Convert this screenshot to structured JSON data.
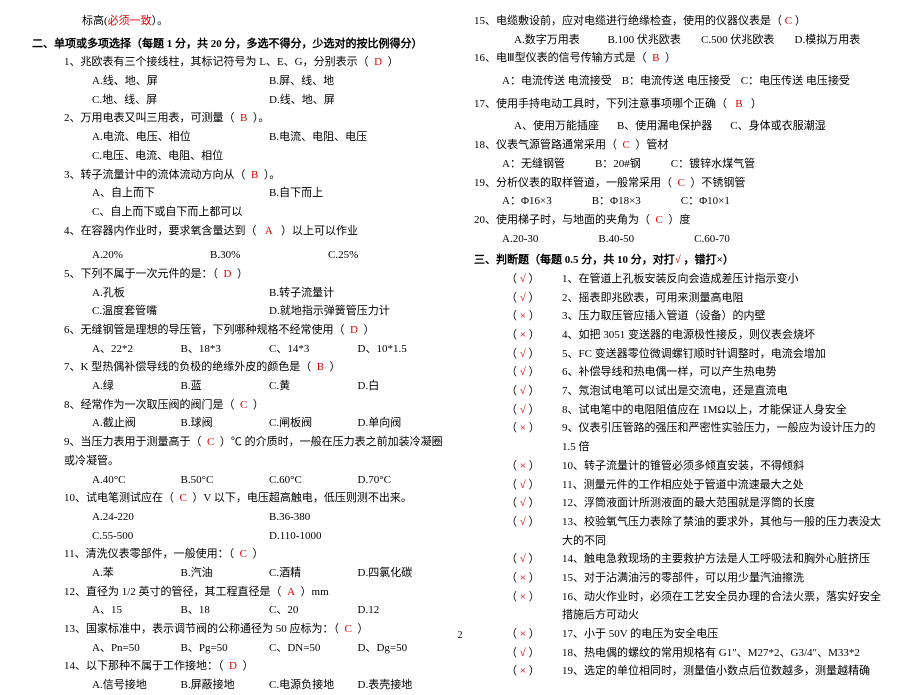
{
  "left": {
    "preline": "标高(",
    "preline_red": "必须一致",
    "preline_end": "）。",
    "sec2_title": "二、单项或多项选择（每题 1 分，共 20 分，多选不得分，少选对的按比例得分）",
    "q1": "1、兆欧表有三个接线柱，其标记符号为 L、E、G，分别表示（",
    "q1_ans": "D",
    "q1_end": "）",
    "q1_opts": [
      "A.线、地、屏",
      "B.屏、线、地",
      "",
      ""
    ],
    "q1_opts2": [
      "C.地、线、屏",
      "D.线、地、屏",
      "",
      ""
    ],
    "q2": "2、万用电表又叫三用表，可测量（",
    "q2_ans": "B",
    "q2_end": "）。",
    "q2_opts": [
      "A.电流、电压、相位",
      "B.电流、电阻、电压",
      "",
      ""
    ],
    "q2_opts2": [
      "C.电压、电流、电阻、相位",
      "",
      "",
      ""
    ],
    "q3": "3、转子流量计中的流体流动方向从（",
    "q3_ans": "B",
    "q3_end": "）。",
    "q3_opts": [
      "A、自上而下",
      "B.自下而上",
      "",
      ""
    ],
    "q3_opts2": [
      "C、自上而下或自下而上都可以",
      "",
      "",
      ""
    ],
    "q4": "4、在容器内作业时，要求氧含量达到（",
    "q4_ans": "A",
    "q4_end": "）以上可以作业",
    "q4_opts": [
      "A.20%",
      "B.30%",
      "C.25%",
      ""
    ],
    "q5": "5、下列不属于一次元件的是：（",
    "q5_ans": "D",
    "q5_end": "）",
    "q5_opts": [
      "A.孔板",
      "B.转子流量计",
      "",
      ""
    ],
    "q5_opts2": [
      "C.温度套管嘴",
      "D.就地指示弹簧管压力计",
      "",
      ""
    ],
    "q6": "6、无缝钢管是理想的导压管，下列哪种规格不经常使用（",
    "q6_ans": "D",
    "q6_end": "）",
    "q6_opts": [
      "A、22*2",
      "B、18*3",
      "C、14*3",
      "D、10*1.5"
    ],
    "q7": "7、K 型热偶补偿导线的负极的绝缘外皮的颜色是（",
    "q7_ans": "B",
    "q7_end": "）",
    "q7_opts": [
      "A.绿",
      "B.蓝",
      "C.黄",
      "D.白"
    ],
    "q8": "8、经常作为一次取压阀的阀门是（",
    "q8_ans": "C",
    "q8_end": "）",
    "q8_opts": [
      "A.截止阀",
      "B.球阀",
      "C.闸板阀",
      "D.单向阀"
    ],
    "q9": "9、当压力表用于测量高于（",
    "q9_ans": "C",
    "q9_end": "）℃ 的介质时，一般在压力表之前加装冷凝圈或冷凝管。",
    "q9_opts": [
      "A.40°C",
      "B.50°C",
      "C.60°C",
      "D.70°C"
    ],
    "q10": "10、试电笔测试应在（",
    "q10_ans": "C",
    "q10_end": "）V 以下，电压超高触电，低压则测不出来。",
    "q10_opts": [
      "A.24-220",
      "B.36-380",
      "",
      ""
    ],
    "q10_opts2": [
      "C.55-500",
      "D.110-1000",
      "",
      ""
    ],
    "q11": "11、清洗仪表零部件，一般使用：（",
    "q11_ans": "C",
    "q11_end": "）",
    "q11_opts": [
      "A.苯",
      "B.汽油",
      "C.酒精",
      "D.四氯化碳"
    ],
    "q12": "12、直径为 1/2 英寸的管径，其工程直径是（",
    "q12_ans": "A",
    "q12_end": "）mm",
    "q12_opts": [
      "A、15",
      "B、18",
      "C、20",
      "D.12"
    ],
    "q13": "13、国家标准中，表示调节阀的公称通径为 50 应标为：（",
    "q13_ans": "C",
    "q13_end": "）",
    "q13_opts": [
      "A、Pn=50",
      "B、Pg=50",
      "C、DN=50",
      "D、Dg=50"
    ],
    "q14": "14、以下那种不属于工作接地：（",
    "q14_ans": "D",
    "q14_end": "）",
    "q14_opts": [
      "A.信号接地",
      "B.屏蔽接地",
      "C.电源负接地",
      "D.表壳接地"
    ]
  },
  "right": {
    "q15": "15、电缆敷设前，应对电缆进行绝缘检查，使用的仪器仪表是（",
    "q15_ans": "C",
    "q15_end": "）",
    "q15_opts": [
      "A.数字万用表",
      "B.100 伏兆欧表",
      "C.500 伏兆欧表",
      "D.模拟万用表"
    ],
    "q16": "16、电Ⅲ型仪表的信号传输方式是（",
    "q16_ans": "B",
    "q16_end": "）",
    "q16_opts": [
      "A：电流传送 电流接受",
      "B：电流传送 电压接受",
      "C：电压传送 电压接受",
      ""
    ],
    "q17": "17、使用手持电动工具时，下列注意事项哪个正确（",
    "q17_ans": "B",
    "q17_end": "）",
    "q17_opts": [
      "A、使用万能插座",
      "B、使用漏电保护器",
      "C、身体或衣服潮湿",
      ""
    ],
    "q18": "18、仪表气源管路通常采用（",
    "q18_ans": "C",
    "q18_end": "）管材",
    "q18_opts": [
      "A：无缝钢管",
      "B：20#钢",
      "C：镀锌水煤气管",
      ""
    ],
    "q19": "19、分析仪表的取样管道，一般常采用（",
    "q19_ans": "C",
    "q19_end": "）不锈钢管",
    "q19_opts": [
      "A：Φ16×3",
      "B：Φ18×3",
      "C：Φ10×1",
      ""
    ],
    "q20": "20、使用梯子时，与地面的夹角为（",
    "q20_ans": "C",
    "q20_end": "）度",
    "q20_opts": [
      "A.20-30",
      "B.40-50",
      "C.60-70",
      ""
    ],
    "sec3_title_a": "三、判断题（每题 0.5 分，共 10 分，对打",
    "sec3_title_b": "√",
    "sec3_title_c": "，错打×）",
    "tf": [
      {
        "m": "√",
        "n": "1",
        "t": "在管道上孔板安装反向会造成差压计指示变小"
      },
      {
        "m": "√",
        "n": "2",
        "t": "摇表即兆欧表，可用来测量高电阻"
      },
      {
        "m": "×",
        "n": "3",
        "t": "压力取压管应插入管道（设备）的内壁"
      },
      {
        "m": "×",
        "n": "4",
        "t": "如把 3051 变送器的电源极性接反，则仪表会烧坏"
      },
      {
        "m": "√",
        "n": "5",
        "t": "FC 变送器零位微调螺钉顺时针调整时，电流会增加"
      },
      {
        "m": "√",
        "n": "6",
        "t": "补偿导线和热电偶一样，可以产生热电势"
      },
      {
        "m": "√",
        "n": "7",
        "t": "氖泡试电笔可以试出是交流电，还是直流电"
      },
      {
        "m": "√",
        "n": "8",
        "t": "试电笔中的电阻阻值应在 1MΩ以上，才能保证人身安全"
      },
      {
        "m": "×",
        "n": "9",
        "t": "仪表引压管路的强压和严密性实验压力，一般应为设计压力的 1.5 倍"
      },
      {
        "m": "×",
        "n": "10",
        "t": "转子流量计的锥管必须多倾直安装，不得倾斜"
      },
      {
        "m": "√",
        "n": "11",
        "t": "测量元件的工作相应处于管道中流速最大之处"
      },
      {
        "m": "√",
        "n": "12",
        "t": "浮筒液面计所测液面的最大范围就是浮筒的长度"
      },
      {
        "m": "√",
        "n": "13",
        "t": "校验氧气压力表除了禁油的要求外，其他与一般的压力表没太大的不同"
      },
      {
        "m": "√",
        "n": "14",
        "t": "触电急救现场的主要救护方法是人工呼吸法和胸外心脏挤压"
      },
      {
        "m": "×",
        "n": "15",
        "t": "对于沾满油污的零部件，可以用少量汽油擦洗"
      },
      {
        "m": "×",
        "n": "16",
        "t": "动火作业时，必须在工艺安全员办理的合法火票，落实好安全措施后方可动火"
      },
      {
        "m": "×",
        "n": "17",
        "t": "小于 50V 的电压为安全电压"
      },
      {
        "m": "√",
        "n": "18",
        "t": "热电偶的螺纹的常用规格有 G1″、M27*2、G3/4″、M33*2"
      },
      {
        "m": "×",
        "n": "19",
        "t": "选定的单位相同时，测量值小数点后位数越多，测量越精确"
      }
    ]
  },
  "page": "2"
}
